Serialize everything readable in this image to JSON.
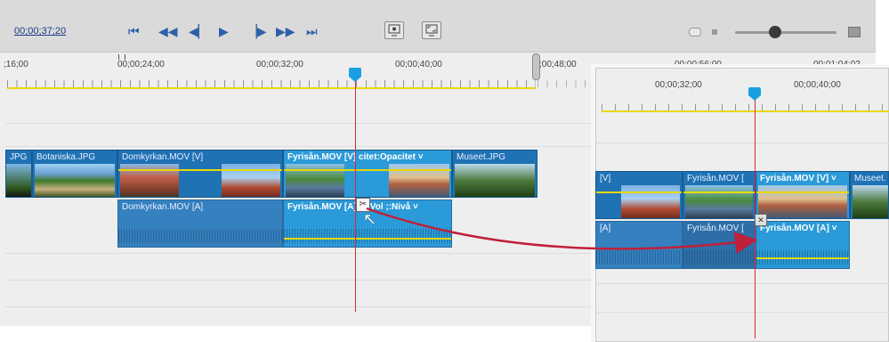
{
  "toolbar": {
    "timecode": "00;00;37;20",
    "transport": [
      {
        "name": "go-to-start-icon",
        "glyph": "⏮"
      },
      {
        "name": "step-back-icon",
        "glyph": "◀◀"
      },
      {
        "name": "prev-frame-icon",
        "glyph": "◀|"
      },
      {
        "name": "play-icon",
        "glyph": "▶"
      },
      {
        "name": "next-frame-icon",
        "glyph": "|▶"
      },
      {
        "name": "step-forward-icon",
        "glyph": "▶▶"
      },
      {
        "name": "go-to-end-icon",
        "glyph": "⏭"
      }
    ],
    "monitor_icons": [
      "monitor-settings-icon",
      "fullscreen-monitor-icon"
    ],
    "zoom_slider_level": 0.45
  },
  "ruler": {
    "labels": [
      ";16;00",
      "00;00;24;00",
      "00;00;32;00",
      "00;00;40;00",
      ";00;48;00",
      "00;00;56;00",
      "00;01;04;02"
    ]
  },
  "tracks": {
    "video_clips": [
      {
        "label": "JPG",
        "selected": false
      },
      {
        "label": "Botaniska.JPG",
        "selected": false
      },
      {
        "label": "Domkyrkan.MOV [V]",
        "selected": false
      },
      {
        "label": "Fyrisån.MOV [V]  citet:Opacitet ˅",
        "selected": true
      },
      {
        "label": "Museet.JPG",
        "selected": false
      }
    ],
    "audio_clips": [
      {
        "label": "Domkyrkan.MOV [A]",
        "selected": false
      },
      {
        "label": "Fyrisån.MOV [A]   id:Vol   ;:Nivå ˅",
        "selected": true
      }
    ]
  },
  "zoom_panel": {
    "ruler_labels": [
      "00;00;32;00",
      "00;00;40;00"
    ],
    "video_clips": [
      {
        "label": "[V]",
        "selected": false
      },
      {
        "label": "Fyrisån.MOV [",
        "selected": false
      },
      {
        "label": "Fyrisån.MOV [V] ˅",
        "selected": true
      },
      {
        "label": "Museet.",
        "selected": false
      }
    ],
    "audio_clips": [
      {
        "label": "[A]",
        "selected": false
      },
      {
        "label": "Fyrisån.MOV [",
        "selected": false
      },
      {
        "label": "Fyrisån.MOV [A] ˅",
        "selected": true
      }
    ]
  },
  "colors": {
    "playhead": "#d8283c",
    "clip_blue": "#1f72b4",
    "clip_selected": "#2a9ad8",
    "arrow": "#c0203a",
    "audio_level": "#e8d800"
  }
}
